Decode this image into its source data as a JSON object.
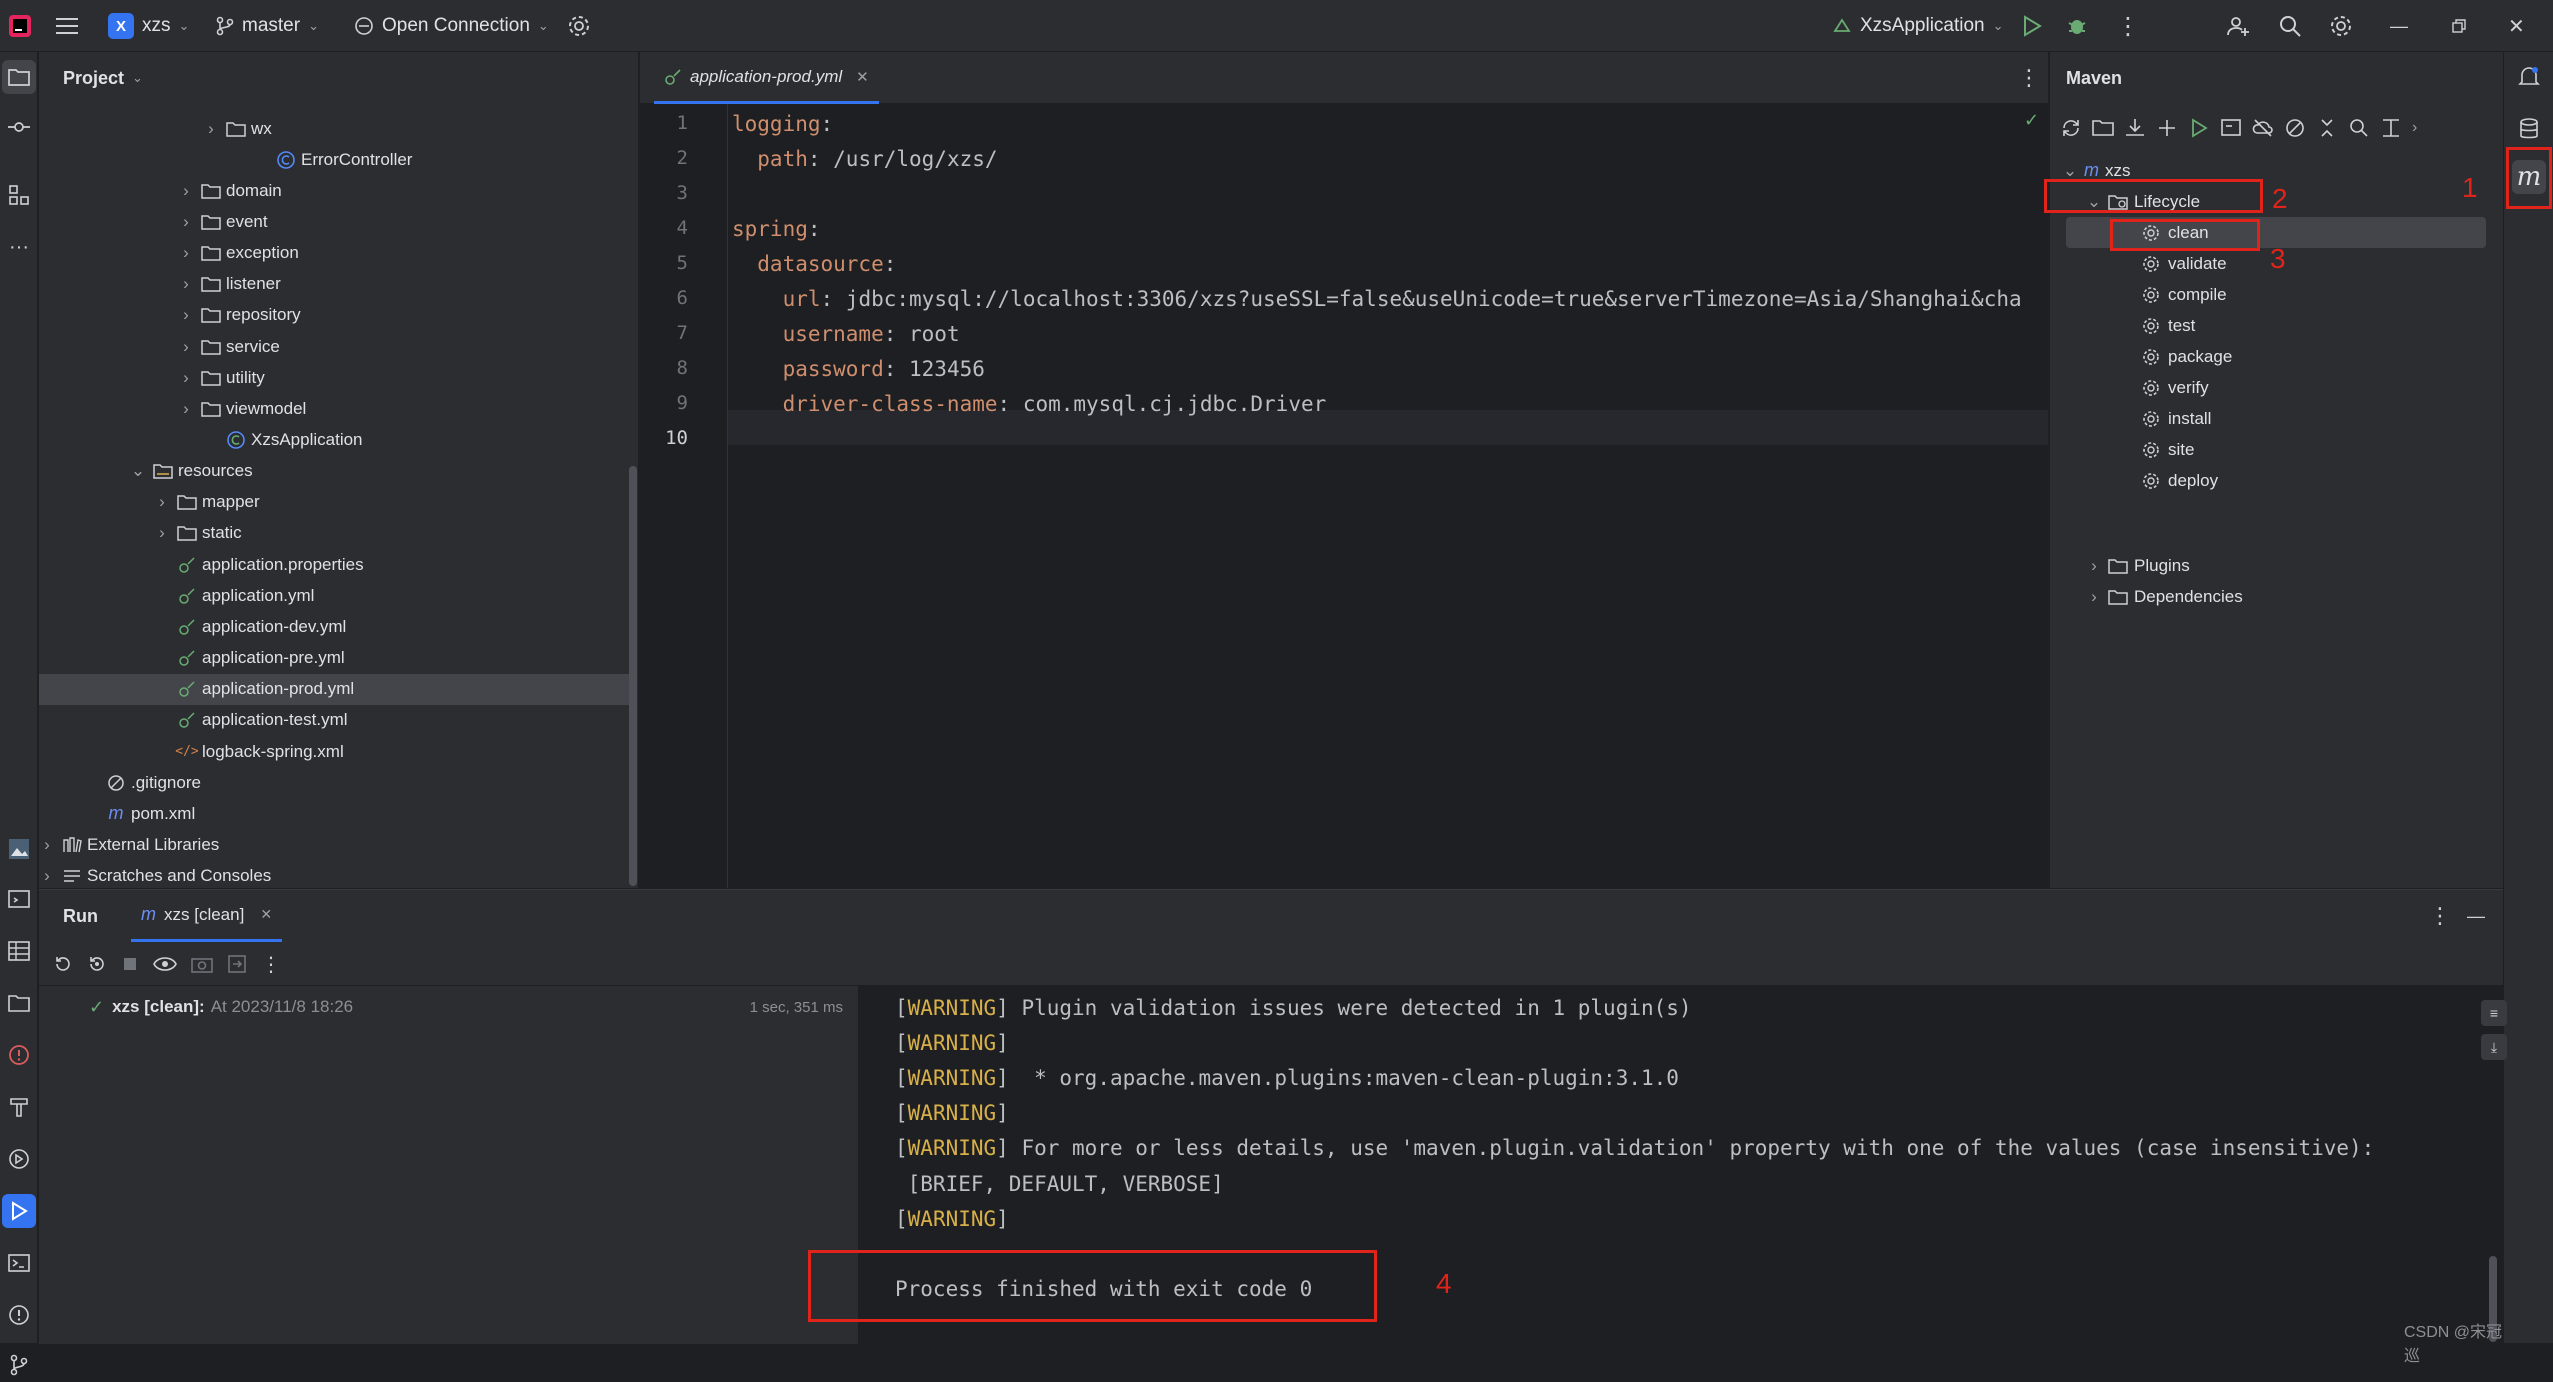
{
  "titlebar": {
    "project_badge": "X",
    "project_name": "xzs",
    "branch": "master",
    "connection": "Open Connection",
    "run_config": "XzsApplication"
  },
  "project_panel": {
    "title": "Project",
    "rows": [
      {
        "label": "wx"
      },
      {
        "label": "ErrorController"
      },
      {
        "label": "domain"
      },
      {
        "label": "event"
      },
      {
        "label": "exception"
      },
      {
        "label": "listener"
      },
      {
        "label": "repository"
      },
      {
        "label": "service"
      },
      {
        "label": "utility"
      },
      {
        "label": "viewmodel"
      },
      {
        "label": "XzsApplication"
      },
      {
        "label": "resources"
      },
      {
        "label": "mapper"
      },
      {
        "label": "static"
      },
      {
        "label": "application.properties"
      },
      {
        "label": "application.yml"
      },
      {
        "label": "application-dev.yml"
      },
      {
        "label": "application-pre.yml"
      },
      {
        "label": "application-prod.yml"
      },
      {
        "label": "application-test.yml"
      },
      {
        "label": "logback-spring.xml"
      },
      {
        "label": ".gitignore"
      },
      {
        "label": "pom.xml"
      },
      {
        "label": "External Libraries"
      },
      {
        "label": "Scratches and Consoles"
      }
    ]
  },
  "editor": {
    "tab_label": "application-prod.yml",
    "line_numbers": [
      "1",
      "2",
      "3",
      "4",
      "5",
      "6",
      "7",
      "8",
      "9",
      "10"
    ],
    "lines": [
      {
        "key": "logging",
        "sep": ":",
        "val": ""
      },
      {
        "key": "  path",
        "sep": ": ",
        "val": "/usr/log/xzs/"
      },
      {
        "key": "",
        "sep": "",
        "val": ""
      },
      {
        "key": "spring",
        "sep": ":",
        "val": ""
      },
      {
        "key": "  datasource",
        "sep": ":",
        "val": ""
      },
      {
        "key": "    url",
        "sep": ": ",
        "val": "jdbc:mysql://localhost:3306/xzs?useSSL=false&useUnicode=true&serverTimezone=Asia/Shanghai&cha"
      },
      {
        "key": "    username",
        "sep": ": ",
        "val": "root"
      },
      {
        "key": "    password",
        "sep": ": ",
        "val": "123456"
      },
      {
        "key": "    driver-class-name",
        "sep": ": ",
        "val": "com.mysql.cj.jdbc.Driver"
      },
      {
        "key": "",
        "sep": "",
        "val": ""
      }
    ]
  },
  "maven": {
    "title": "Maven",
    "project": "xzs",
    "lifecycle": "Lifecycle",
    "goals": [
      "clean",
      "validate",
      "compile",
      "test",
      "package",
      "verify",
      "install",
      "site",
      "deploy"
    ],
    "plugins": "Plugins",
    "dependencies": "Dependencies"
  },
  "annotations": {
    "n1": "1",
    "n2": "2",
    "n3": "3",
    "n4": "4"
  },
  "run_panel": {
    "title": "Run",
    "tab_label": "xzs [clean]",
    "run_item_name": "xzs [clean]:",
    "run_item_time": "At 2023/11/8 18:26",
    "run_item_duration": "1 sec, 351 ms",
    "console": [
      {
        "tag": "[WARNING]",
        "text": " Plugin validation issues were detected in 1 plugin(s)"
      },
      {
        "tag": "[WARNING]",
        "text": ""
      },
      {
        "tag": "[WARNING]",
        "text": "  * org.apache.maven.plugins:maven-clean-plugin:3.1.0"
      },
      {
        "tag": "[WARNING]",
        "text": ""
      },
      {
        "tag": "[WARNING]",
        "text": " For more or less details, use 'maven.plugin.validation' property with one of the values (case insensitive):"
      },
      {
        "tag": "",
        "text": " [BRIEF, DEFAULT, VERBOSE]"
      },
      {
        "tag": "[WARNING]",
        "text": ""
      },
      {
        "tag": "",
        "text": ""
      },
      {
        "tag": "",
        "text": "Process finished with exit code 0"
      }
    ],
    "watermark": "CSDN @宋冠巡"
  },
  "colors": {
    "accent": "#3574f0",
    "annotation_red": "#e0241b",
    "warning": "#d8b04a",
    "yaml_key": "#cf8e6d"
  }
}
